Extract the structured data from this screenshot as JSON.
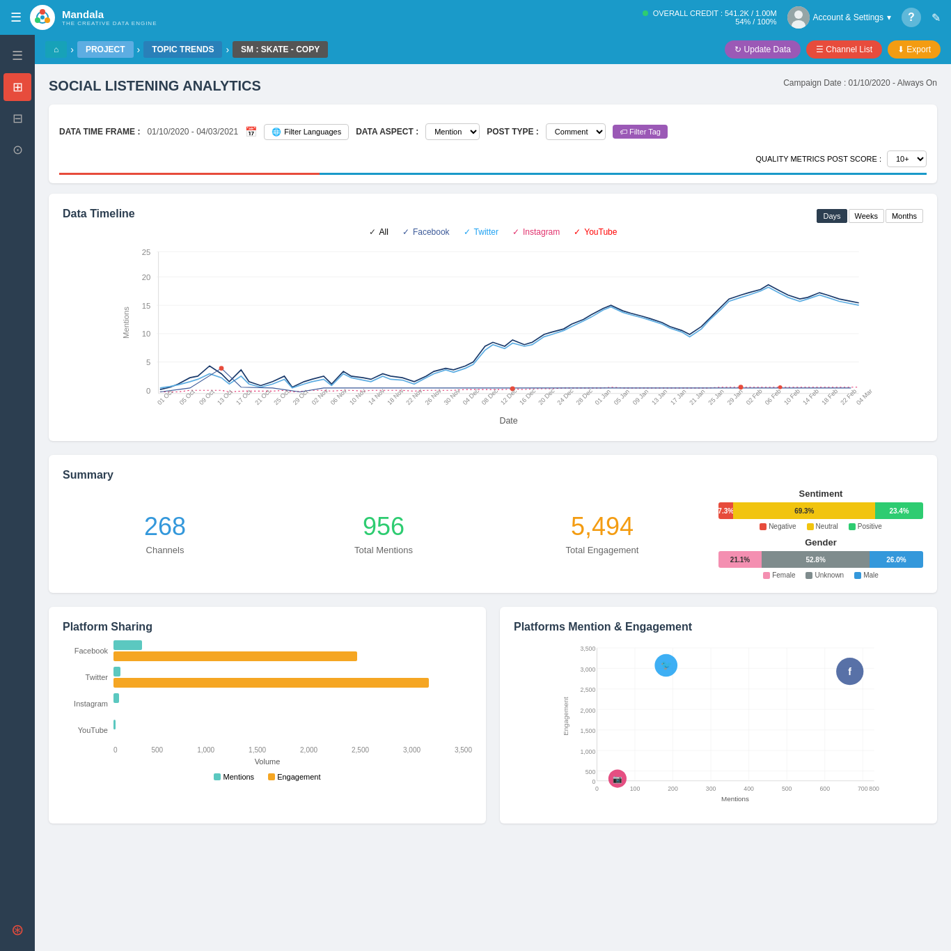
{
  "topnav": {
    "hamburger": "☰",
    "logo_text": "Mandala",
    "logo_sub": "THE CREATIVE DATA ENGINE",
    "credit_label": "OVERALL CREDIT : 541.2K / 1.00M",
    "credit_percent": "54% / 100%",
    "credit_dot_color": "#2ecc71",
    "account_label": "Account & Settings",
    "account_arrow": "▾",
    "help_icon": "?",
    "edit_icon": "✎"
  },
  "sidebar": {
    "items": [
      {
        "icon": "☰",
        "active": false
      },
      {
        "icon": "⊞",
        "active": true
      },
      {
        "icon": "⊟",
        "active": false
      },
      {
        "icon": "⊙",
        "active": false
      },
      {
        "icon": "⊛",
        "active": false
      }
    ]
  },
  "subnav": {
    "home_icon": "⌂",
    "project_label": "PROJECT",
    "topic_label": "TOPIC TRENDS",
    "current_label": "SM : SKATE - COPY",
    "update_btn": "↻ Update Data",
    "channel_btn": "☰ Channel List",
    "export_btn": "⬇ Export"
  },
  "page": {
    "title": "SOCIAL LISTENING ANALYTICS",
    "campaign_date": "Campaign Date : 01/10/2020 - Always On"
  },
  "filters": {
    "timeframe_label": "DATA TIME FRAME :",
    "timeframe_value": "01/10/2020 - 04/03/2021",
    "filter_lang_btn": "Filter Languages",
    "aspect_label": "DATA ASPECT :",
    "aspect_value": "Mention",
    "post_type_label": "POST TYPE :",
    "post_type_value": "Comment",
    "filter_tag_btn": "🏷 Filter Tag",
    "quality_label": "QUALITY METRICS  POST SCORE :",
    "quality_value": "10+"
  },
  "timeline": {
    "title": "Data Timeline",
    "legends": [
      {
        "label": "All",
        "color": "#333"
      },
      {
        "label": "Facebook",
        "color": "#3b5998"
      },
      {
        "label": "Twitter",
        "color": "#1da1f2"
      },
      {
        "label": "Instagram",
        "color": "#e1306c"
      },
      {
        "label": "YouTube",
        "color": "#ff0000"
      }
    ],
    "controls": [
      "Days",
      "Weeks",
      "Months"
    ],
    "active_control": "Days",
    "x_label": "Date",
    "y_label": "Mentions",
    "y_max": 25
  },
  "summary": {
    "title": "Summary",
    "channels_count": "268",
    "channels_label": "Channels",
    "mentions_count": "956",
    "mentions_label": "Total Mentions",
    "engagement_count": "5,494",
    "engagement_label": "Total Engagement",
    "sentiment": {
      "title": "Sentiment",
      "negative_pct": "7.3%",
      "neutral_pct": "69.3%",
      "positive_pct": "23.4%",
      "neg_color": "#e74c3c",
      "neutral_color": "#f1c40f",
      "pos_color": "#2ecc71",
      "neg_label": "Negative",
      "neutral_label": "Neutral",
      "pos_label": "Positive"
    },
    "gender": {
      "title": "Gender",
      "female_pct": "21.1%",
      "unknown_pct": "52.8%",
      "male_pct": "26.0%",
      "female_label": "Female",
      "unknown_label": "Unknown",
      "male_label": "Male"
    }
  },
  "platform_sharing": {
    "title": "Platform Sharing",
    "x_label": "Volume",
    "platforms": [
      {
        "name": "Facebook",
        "mentions": 280,
        "engagement": 2400
      },
      {
        "name": "Twitter",
        "mentions": 80,
        "engagement": 3100
      },
      {
        "name": "Instagram",
        "mentions": 50,
        "engagement": 0
      },
      {
        "name": "YouTube",
        "mentions": 20,
        "engagement": 0
      }
    ],
    "x_ticks": [
      "0",
      "500",
      "1,000",
      "1,500",
      "2,000",
      "2,500",
      "3,000",
      "3,500"
    ],
    "max_val": 3500,
    "mention_label": "Mentions",
    "engagement_label": "Engagement"
  },
  "platform_scatter": {
    "title": "Platforms Mention & Engagement",
    "x_label": "Mentions",
    "y_label": "Engagement",
    "y_max": 3500,
    "y_ticks": [
      "0",
      "500",
      "1,000",
      "1,500",
      "2,000",
      "2,500",
      "3,000",
      "3,500"
    ],
    "x_max": 800,
    "x_ticks": [
      "0",
      "100",
      "200",
      "300",
      "400",
      "500",
      "600",
      "700",
      "800"
    ],
    "points": [
      {
        "platform": "Twitter",
        "x": 200,
        "y": 3050,
        "color": "#1da1f2",
        "icon": "🐦"
      },
      {
        "platform": "Facebook",
        "x": 730,
        "y": 2870,
        "color": "#3b5998",
        "icon": "f"
      },
      {
        "platform": "Instagram",
        "x": 60,
        "y": 50,
        "color": "#e1306c",
        "icon": "📷"
      }
    ]
  }
}
